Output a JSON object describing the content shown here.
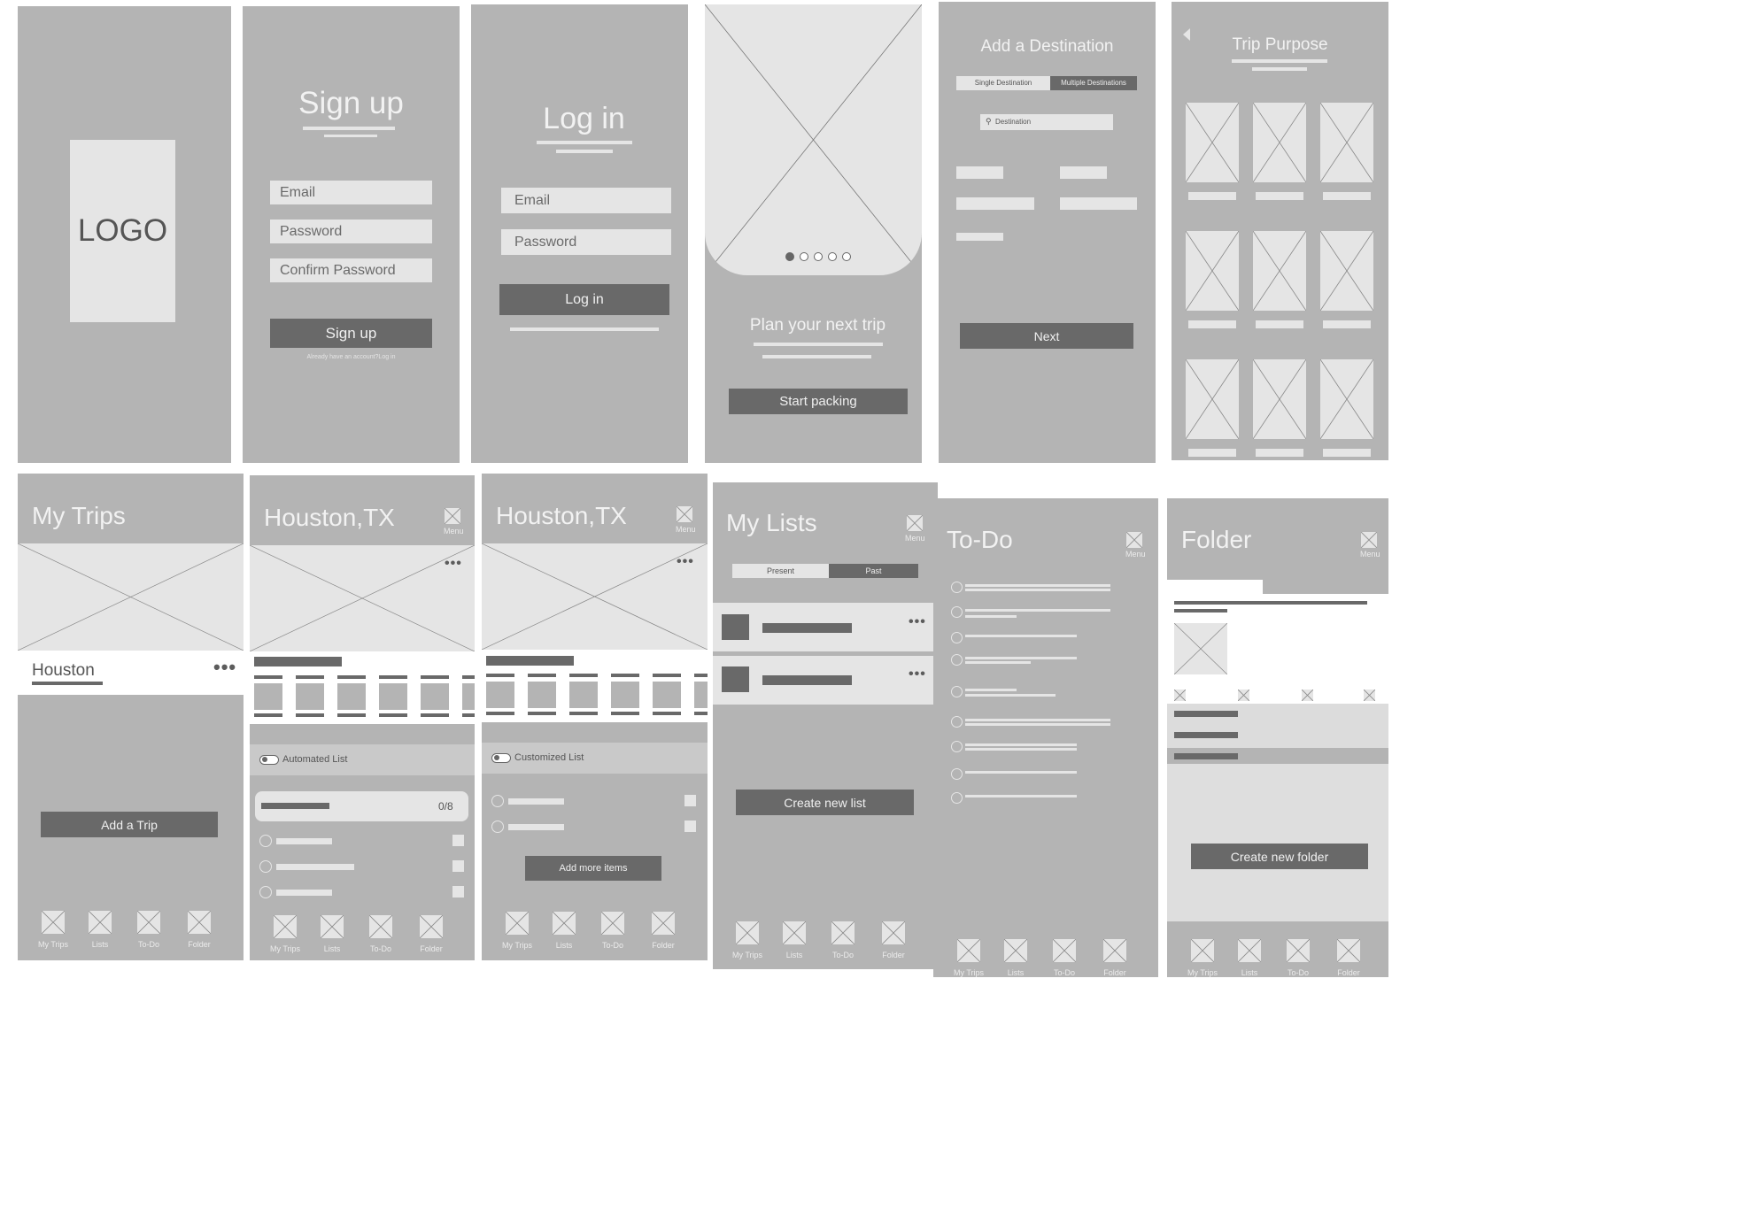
{
  "logo_screen": {
    "logo_text": "LOGO"
  },
  "signup_screen": {
    "title": "Sign up",
    "email_placeholder": "Email",
    "password_placeholder": "Password",
    "confirm_placeholder": "Confirm Password",
    "button_label": "Sign up",
    "footer_text": "Already have an account?Log in"
  },
  "login_screen": {
    "title": "Log in",
    "email_placeholder": "Email",
    "password_placeholder": "Password",
    "button_label": "Log in"
  },
  "onboarding_screen": {
    "headline": "Plan your next trip",
    "button_label": "Start packing",
    "page_count": 5,
    "active_page": 1
  },
  "destination_screen": {
    "title": "Add a Destination",
    "segment_single": "Single Destination",
    "segment_multiple": "Multiple Destinations",
    "search_placeholder": "Destination",
    "button_label": "Next"
  },
  "purpose_screen": {
    "title": "Trip Purpose"
  },
  "mytrips_screen": {
    "title": "My Trips",
    "trip_name": "Houston",
    "button_label": "Add a Trip"
  },
  "houston_auto_screen": {
    "title": "Houston,TX",
    "menu_label": "Menu",
    "toggle_label": "Automated List",
    "progress_text": "0/8"
  },
  "houston_custom_screen": {
    "title": "Houston,TX",
    "menu_label": "Menu",
    "toggle_label": "Customized List",
    "button_label": "Add more items"
  },
  "mylists_screen": {
    "title": "My Lists",
    "menu_label": "Menu",
    "tab_present": "Present",
    "tab_past": "Past",
    "button_label": "Create new list"
  },
  "todo_screen": {
    "title": "To-Do",
    "menu_label": "Menu"
  },
  "folder_screen": {
    "title": "Folder",
    "menu_label": "Menu",
    "button_label": "Create new folder"
  },
  "nav": {
    "my_trips": "My Trips",
    "lists": "Lists",
    "todo": "To-Do",
    "folder": "Folder"
  },
  "colors": {
    "screen_bg": "#b4b4b4",
    "placeholder": "#e5e5e5",
    "dark": "#696969"
  }
}
